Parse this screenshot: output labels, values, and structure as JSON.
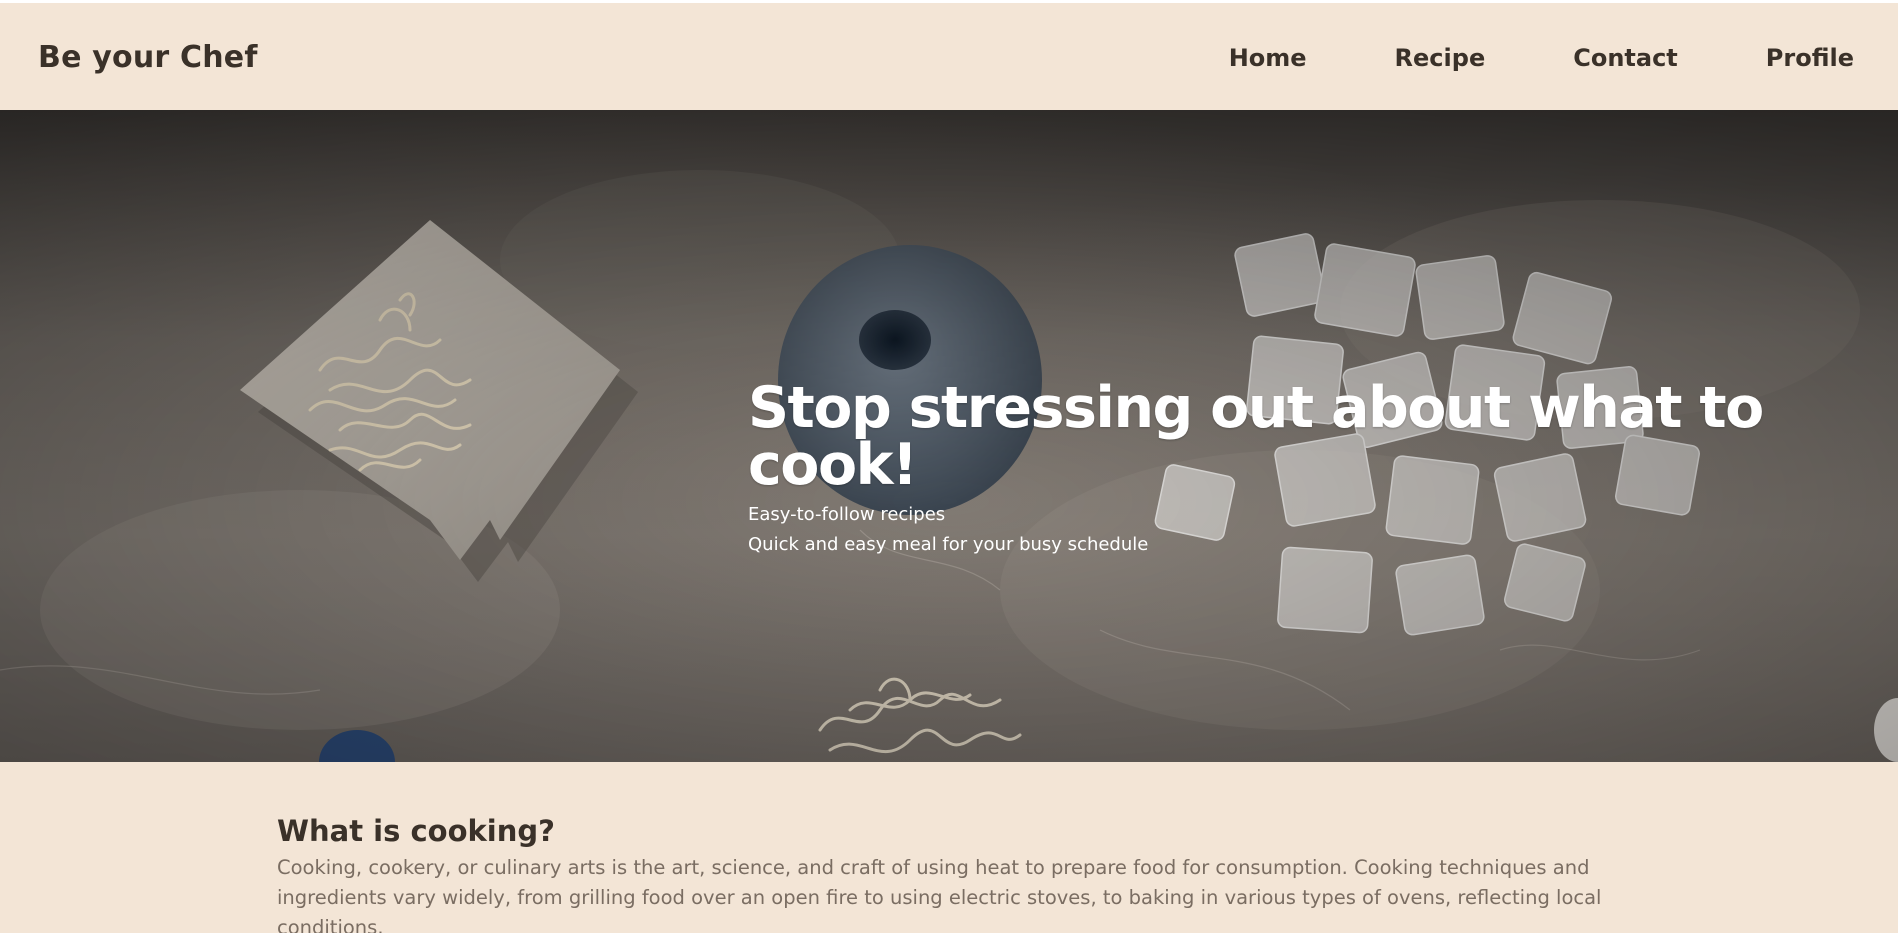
{
  "brand": {
    "title": "Be your Chef"
  },
  "nav": {
    "items": [
      {
        "label": "Home"
      },
      {
        "label": "Recipe"
      },
      {
        "label": "Contact"
      },
      {
        "label": "Profile"
      }
    ]
  },
  "hero": {
    "title": "Stop stressing out about what to cook!",
    "lines": [
      "Easy-to-follow recipes",
      "Quick and easy meal for your busy schedule"
    ]
  },
  "section": {
    "title": "What is cooking?",
    "body": "Cooking, cookery, or culinary arts is the art, science, and craft of using heat to prepare food for consumption. Cooking techniques and ingredients vary widely, from grilling food over an open fire to using electric stoves, to baking in various types of ovens, reflecting local conditions."
  },
  "colors": {
    "background": "#f3e5d6",
    "text_dark": "#3a3129",
    "text_muted": "#7a6d62",
    "hero_text": "#ffffff"
  }
}
